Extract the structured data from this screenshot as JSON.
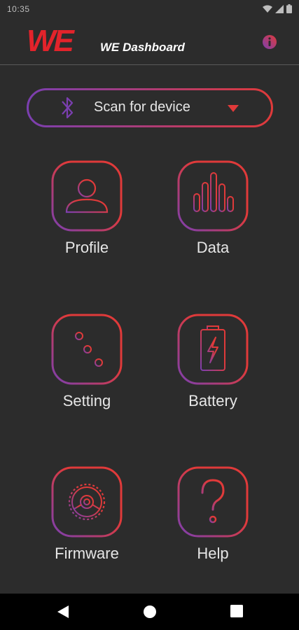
{
  "status_bar": {
    "time": "10:35",
    "icons": [
      "wifi-icon",
      "signal-icon",
      "battery-icon"
    ]
  },
  "app_bar": {
    "logo_mark": "WE",
    "title": "WE Dashboard",
    "info_icon": "info-icon"
  },
  "scan": {
    "label": "Scan for device",
    "icon": "bluetooth-icon"
  },
  "tiles": [
    {
      "label": "Profile",
      "icon": "profile-icon"
    },
    {
      "label": "Data",
      "icon": "bar-chart-icon"
    },
    {
      "label": "Setting",
      "icon": "sliders-icon"
    },
    {
      "label": "Battery",
      "icon": "battery-charging-icon"
    },
    {
      "label": "Firmware",
      "icon": "gear-icon"
    },
    {
      "label": "Help",
      "icon": "question-icon"
    }
  ],
  "nav": [
    "back-icon",
    "home-icon",
    "recents-icon"
  ],
  "colors": {
    "background": "#2c2c2c",
    "accent_red": "#e03a3a",
    "accent_purple": "#7b3fb0",
    "text": "#e6e6e6"
  }
}
